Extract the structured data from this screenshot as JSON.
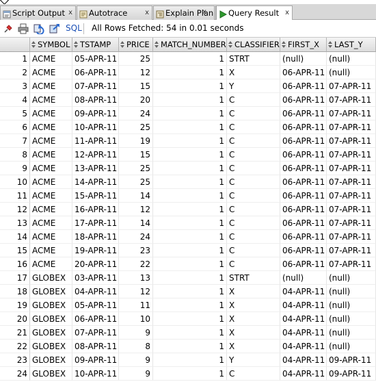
{
  "tabs": [
    {
      "label": "Script Output",
      "icon": "script-output-icon",
      "close": "x"
    },
    {
      "label": "Autotrace",
      "icon": "autotrace-icon",
      "close": "x"
    },
    {
      "label": "Explain Plan",
      "icon": "explain-plan-icon",
      "close": "x"
    },
    {
      "label": "Query Result",
      "icon": "run-query-icon",
      "close": "x"
    }
  ],
  "toolbar": {
    "icons": [
      "pin-icon",
      "print-icon",
      "refresh-icon",
      "export-icon"
    ],
    "sql_label": "SQL",
    "status": "All Rows Fetched: 54 in 0.01 seconds"
  },
  "colors": {
    "accent_blue": "#1a4fb5",
    "run_green": "#2e9a2e"
  },
  "table": {
    "columns": [
      "SYMBOL",
      "TSTAMP",
      "PRICE",
      "MATCH_NUMBER",
      "CLASSIFIER",
      "FIRST_X",
      "LAST_Y"
    ],
    "rows": [
      [
        "1",
        "ACME",
        "05-APR-11",
        "25",
        "1",
        "STRT",
        "(null)",
        "(null)"
      ],
      [
        "2",
        "ACME",
        "06-APR-11",
        "12",
        "1",
        "X",
        "06-APR-11",
        "(null)"
      ],
      [
        "3",
        "ACME",
        "07-APR-11",
        "15",
        "1",
        "Y",
        "06-APR-11",
        "07-APR-11"
      ],
      [
        "4",
        "ACME",
        "08-APR-11",
        "20",
        "1",
        "C",
        "06-APR-11",
        "07-APR-11"
      ],
      [
        "5",
        "ACME",
        "09-APR-11",
        "24",
        "1",
        "C",
        "06-APR-11",
        "07-APR-11"
      ],
      [
        "6",
        "ACME",
        "10-APR-11",
        "25",
        "1",
        "C",
        "06-APR-11",
        "07-APR-11"
      ],
      [
        "7",
        "ACME",
        "11-APR-11",
        "19",
        "1",
        "C",
        "06-APR-11",
        "07-APR-11"
      ],
      [
        "8",
        "ACME",
        "12-APR-11",
        "15",
        "1",
        "C",
        "06-APR-11",
        "07-APR-11"
      ],
      [
        "9",
        "ACME",
        "13-APR-11",
        "25",
        "1",
        "C",
        "06-APR-11",
        "07-APR-11"
      ],
      [
        "10",
        "ACME",
        "14-APR-11",
        "25",
        "1",
        "C",
        "06-APR-11",
        "07-APR-11"
      ],
      [
        "11",
        "ACME",
        "15-APR-11",
        "14",
        "1",
        "C",
        "06-APR-11",
        "07-APR-11"
      ],
      [
        "12",
        "ACME",
        "16-APR-11",
        "12",
        "1",
        "C",
        "06-APR-11",
        "07-APR-11"
      ],
      [
        "13",
        "ACME",
        "17-APR-11",
        "14",
        "1",
        "C",
        "06-APR-11",
        "07-APR-11"
      ],
      [
        "14",
        "ACME",
        "18-APR-11",
        "24",
        "1",
        "C",
        "06-APR-11",
        "07-APR-11"
      ],
      [
        "15",
        "ACME",
        "19-APR-11",
        "23",
        "1",
        "C",
        "06-APR-11",
        "07-APR-11"
      ],
      [
        "16",
        "ACME",
        "20-APR-11",
        "22",
        "1",
        "C",
        "06-APR-11",
        "07-APR-11"
      ],
      [
        "17",
        "GLOBEX",
        "03-APR-11",
        "13",
        "1",
        "STRT",
        "(null)",
        "(null)"
      ],
      [
        "18",
        "GLOBEX",
        "04-APR-11",
        "12",
        "1",
        "X",
        "04-APR-11",
        "(null)"
      ],
      [
        "19",
        "GLOBEX",
        "05-APR-11",
        "11",
        "1",
        "X",
        "04-APR-11",
        "(null)"
      ],
      [
        "20",
        "GLOBEX",
        "06-APR-11",
        "10",
        "1",
        "X",
        "04-APR-11",
        "(null)"
      ],
      [
        "21",
        "GLOBEX",
        "07-APR-11",
        "9",
        "1",
        "X",
        "04-APR-11",
        "(null)"
      ],
      [
        "22",
        "GLOBEX",
        "08-APR-11",
        "8",
        "1",
        "X",
        "04-APR-11",
        "(null)"
      ],
      [
        "23",
        "GLOBEX",
        "09-APR-11",
        "9",
        "1",
        "Y",
        "04-APR-11",
        "09-APR-11"
      ],
      [
        "24",
        "GLOBEX",
        "10-APR-11",
        "9",
        "1",
        "C",
        "04-APR-11",
        "09-APR-11"
      ]
    ]
  }
}
